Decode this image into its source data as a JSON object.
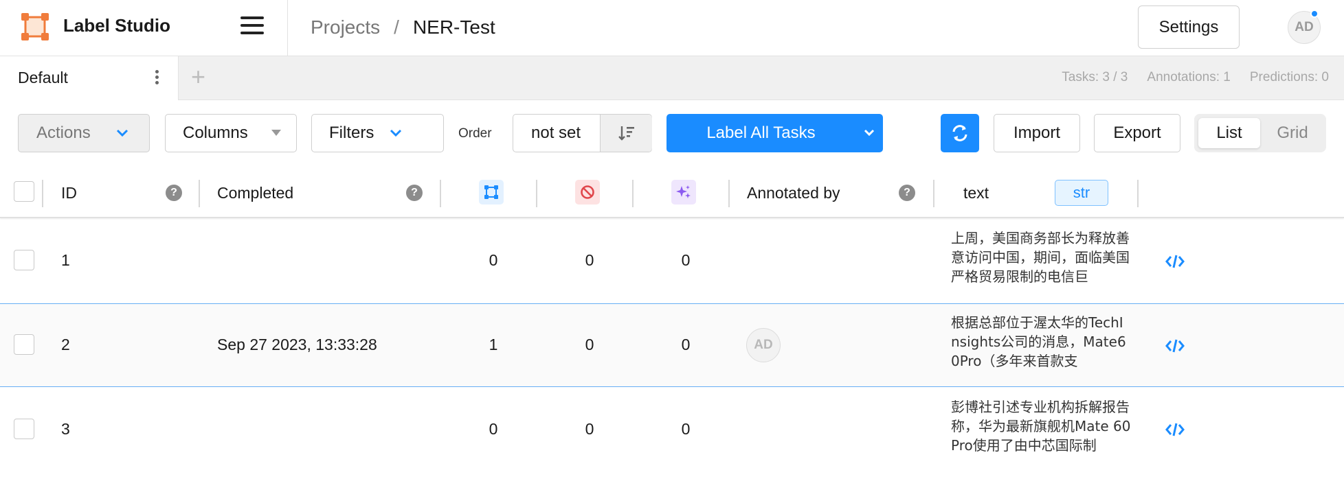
{
  "app": {
    "name": "Label Studio"
  },
  "breadcrumb": {
    "projects": "Projects",
    "separator": "/",
    "current": "NER-Test"
  },
  "header": {
    "settings_label": "Settings",
    "avatar_initials": "AD"
  },
  "tabs": {
    "default_label": "Default",
    "add_label": "+"
  },
  "stats": {
    "tasks": "Tasks: 3 / 3",
    "annotations": "Annotations: 1",
    "predictions": "Predictions: 0"
  },
  "toolbar": {
    "actions": "Actions",
    "columns": "Columns",
    "filters": "Filters",
    "order_label": "Order",
    "order_value": "not set",
    "label_all": "Label All Tasks",
    "import": "Import",
    "export": "Export",
    "view_list": "List",
    "view_grid": "Grid"
  },
  "table": {
    "headers": {
      "id": "ID",
      "completed": "Completed",
      "annotated_by": "Annotated by",
      "text": "text",
      "text_type": "str",
      "help": "?"
    },
    "rows": [
      {
        "id": "1",
        "completed": "",
        "annotations": "0",
        "cancelled": "0",
        "predictions": "0",
        "annotator": "",
        "text": "上周，美国商务部长为释放善意访问中国，期间，面临美国严格贸易限制的电信巨"
      },
      {
        "id": "2",
        "completed": "Sep 27 2023, 13:33:28",
        "annotations": "1",
        "cancelled": "0",
        "predictions": "0",
        "annotator": "AD",
        "text": "根据总部位于渥太华的TechInsights公司的消息，Mate60Pro（多年来首款支"
      },
      {
        "id": "3",
        "completed": "",
        "annotations": "0",
        "cancelled": "0",
        "predictions": "0",
        "annotator": "",
        "text": "彭博社引述专业机构拆解报告称，华为最新旗舰机Mate 60 Pro使用了由中芯国际制"
      }
    ]
  },
  "colors": {
    "accent": "#1a8cff",
    "logo": "#f07c3c",
    "cancel": "#e0464b",
    "predict": "#8c5cf0"
  },
  "icons": [
    "hamburger-icon",
    "chevron-down-icon",
    "sort-icon",
    "refresh-icon",
    "help-icon",
    "annotations-icon",
    "cancelled-icon",
    "predictions-icon",
    "code-icon",
    "kebab-icon"
  ]
}
